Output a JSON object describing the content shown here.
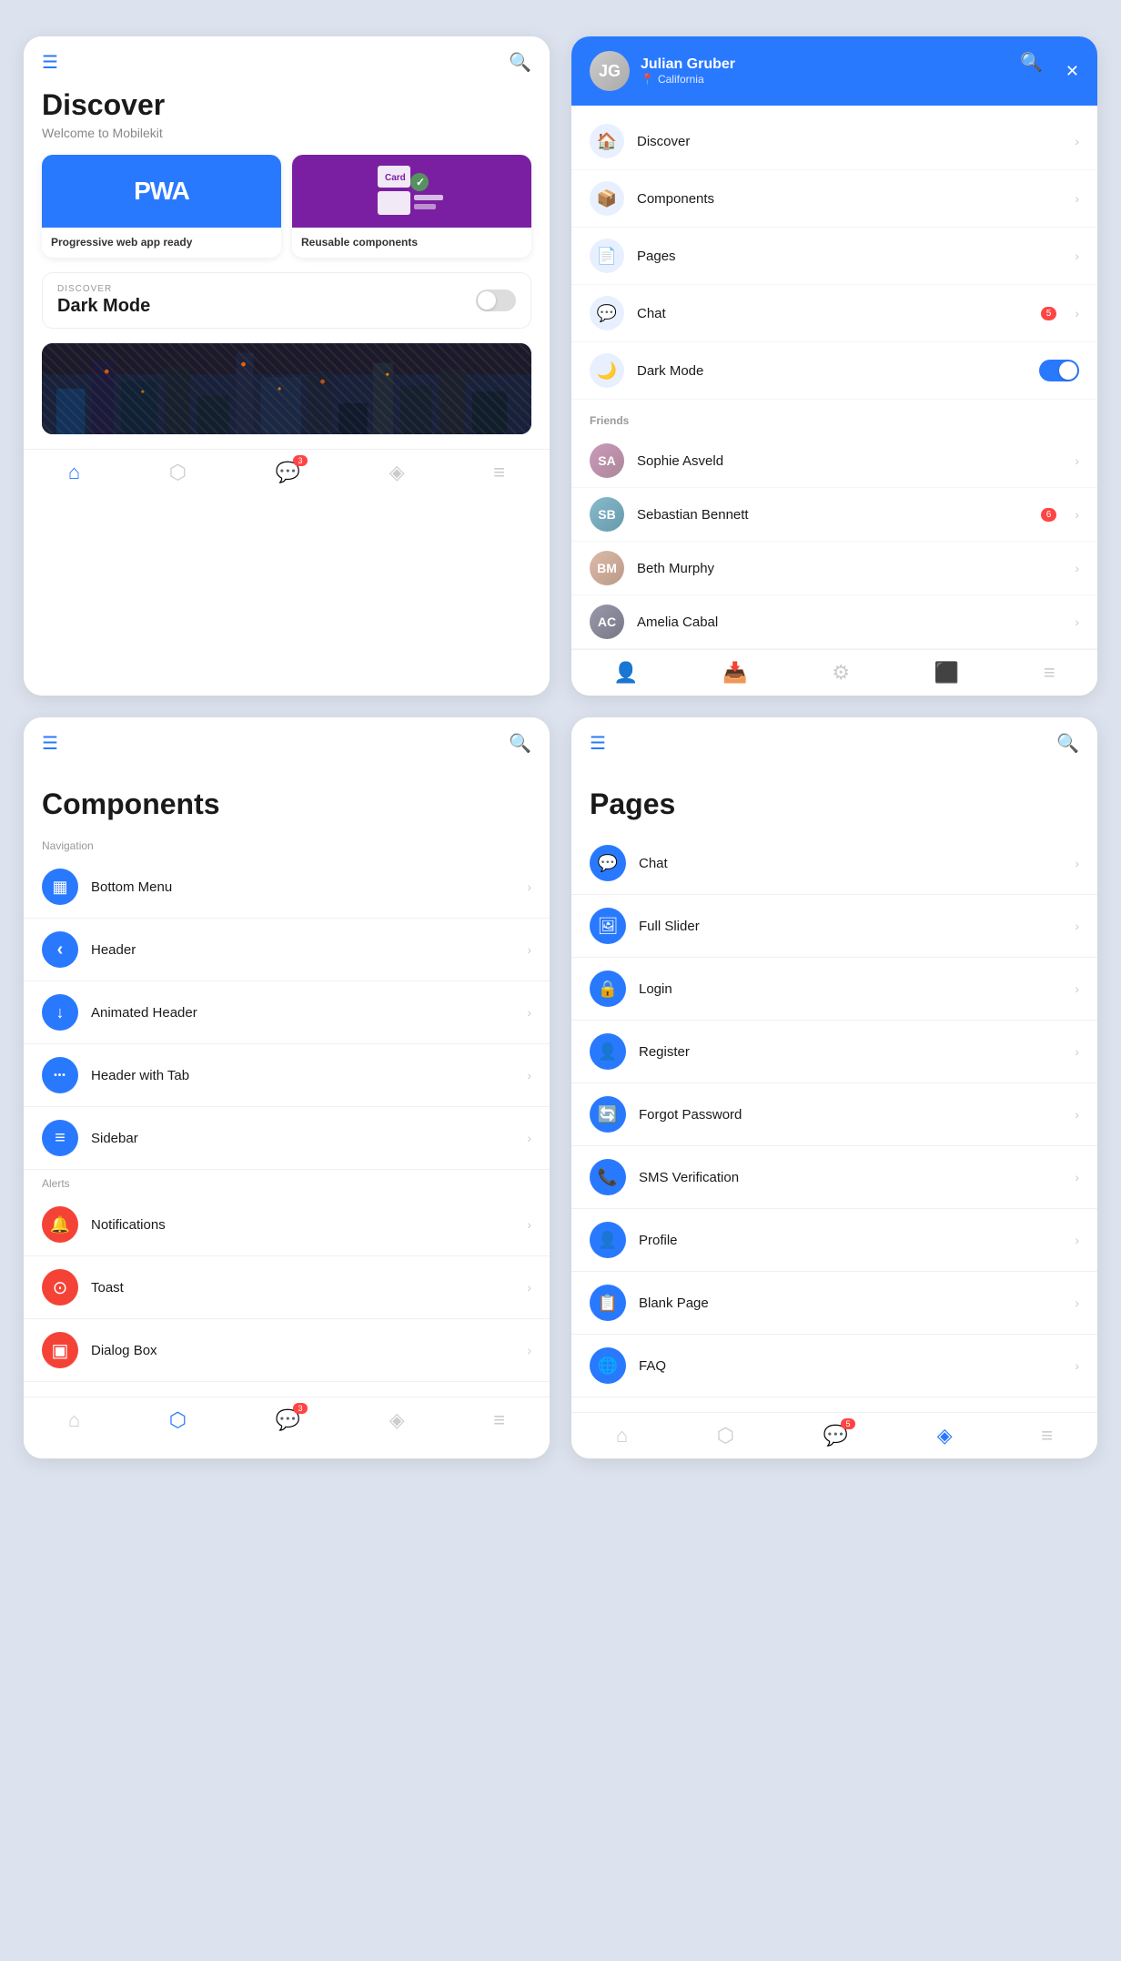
{
  "colors": {
    "blue": "#2979FF",
    "red": "#f44336",
    "orange": "#FF5722",
    "gray": "#888",
    "lightGray": "#ddd",
    "accent": "#2979FF"
  },
  "discover": {
    "title": "Discover",
    "subtitle": "Welcome to Mobilekit",
    "darkModeLabel": "DISCOVER",
    "darkModeTitle": "Dark Mode",
    "features": [
      {
        "id": "pwa",
        "label": "Progressive web app ready",
        "icon": "PWA"
      },
      {
        "id": "components",
        "label": "Reusable components",
        "icon": "⚙"
      }
    ]
  },
  "sidebar": {
    "userName": "Julian Gruber",
    "userLocation": "California",
    "menuItems": [
      {
        "id": "discover",
        "label": "Discover",
        "icon": "🏠"
      },
      {
        "id": "components",
        "label": "Components",
        "icon": "📦"
      },
      {
        "id": "pages",
        "label": "Pages",
        "icon": "📄"
      },
      {
        "id": "chat",
        "label": "Chat",
        "icon": "💬",
        "badge": "5"
      },
      {
        "id": "darkmode",
        "label": "Dark Mode",
        "icon": "🌙",
        "toggle": true
      }
    ],
    "friends": [
      {
        "id": "sophie",
        "name": "Sophie Asveld"
      },
      {
        "id": "sebastian",
        "name": "Sebastian Bennett",
        "badge": "6"
      },
      {
        "id": "beth",
        "name": "Beth Murphy"
      },
      {
        "id": "amelia",
        "name": "Amelia Cabal"
      }
    ]
  },
  "components": {
    "title": "Components",
    "sections": [
      {
        "label": "Navigation",
        "items": [
          {
            "id": "bottom-menu",
            "label": "Bottom Menu",
            "icon": "▦",
            "color": "blue"
          },
          {
            "id": "header",
            "label": "Header",
            "icon": "‹",
            "color": "blue"
          },
          {
            "id": "animated-header",
            "label": "Animated Header",
            "icon": "↓",
            "color": "blue"
          },
          {
            "id": "header-tab",
            "label": "Header with Tab",
            "icon": "•••",
            "color": "blue"
          },
          {
            "id": "sidebar",
            "label": "Sidebar",
            "icon": "≡",
            "color": "blue"
          }
        ]
      },
      {
        "label": "Alerts",
        "items": [
          {
            "id": "notifications",
            "label": "Notifications",
            "icon": "🔔",
            "color": "red"
          },
          {
            "id": "toast",
            "label": "Toast",
            "icon": "⊙",
            "color": "red"
          },
          {
            "id": "dialog",
            "label": "Dialog Box",
            "icon": "▣",
            "color": "red"
          }
        ]
      }
    ]
  },
  "pages": {
    "title": "Pages",
    "items": [
      {
        "id": "chat",
        "label": "Chat",
        "icon": "💬"
      },
      {
        "id": "full-slider",
        "label": "Full Slider",
        "icon": "🖼"
      },
      {
        "id": "login",
        "label": "Login",
        "icon": "🔒"
      },
      {
        "id": "register",
        "label": "Register",
        "icon": "👤"
      },
      {
        "id": "forgot-password",
        "label": "Forgot Password",
        "icon": "🔄"
      },
      {
        "id": "sms",
        "label": "SMS Verification",
        "icon": "📞"
      },
      {
        "id": "profile",
        "label": "Profile",
        "icon": "👤"
      },
      {
        "id": "blank",
        "label": "Blank Page",
        "icon": "📋"
      },
      {
        "id": "faq",
        "label": "FAQ",
        "icon": "🌐"
      }
    ]
  },
  "bottomNav": {
    "items": [
      {
        "id": "home",
        "label": "Home",
        "icon": "⌂",
        "active": true
      },
      {
        "id": "box",
        "label": "Components",
        "icon": "⬡"
      },
      {
        "id": "chat",
        "label": "Chat",
        "icon": "💬",
        "badge": "3"
      },
      {
        "id": "layers",
        "label": "Pages",
        "icon": "◈"
      },
      {
        "id": "menu",
        "label": "Menu",
        "icon": "≡"
      }
    ]
  }
}
